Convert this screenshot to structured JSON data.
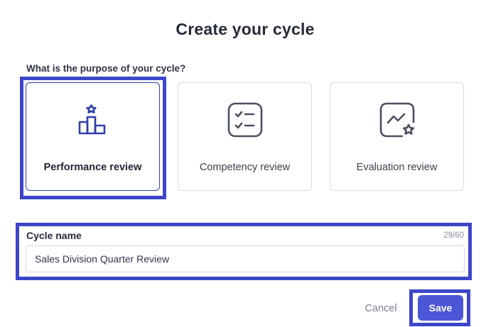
{
  "dialog": {
    "title": "Create your cycle",
    "purpose_label": "What is the purpose of your cycle?"
  },
  "purpose_options": [
    {
      "label": "Performance review",
      "icon": "podium-star-icon",
      "selected": true
    },
    {
      "label": "Competency review",
      "icon": "checklist-icon",
      "selected": false
    },
    {
      "label": "Evaluation review",
      "icon": "chart-star-icon",
      "selected": false
    }
  ],
  "cycle_name": {
    "label": "Cycle name",
    "value": "Sales Division Quarter Review",
    "counter": "29/60"
  },
  "actions": {
    "cancel_label": "Cancel",
    "save_label": "Save"
  },
  "colors": {
    "accent": "#4b57d6",
    "highlight": "#3d46c9",
    "selected_icon": "#2f3fa8",
    "unselected_icon": "#4a5060"
  }
}
